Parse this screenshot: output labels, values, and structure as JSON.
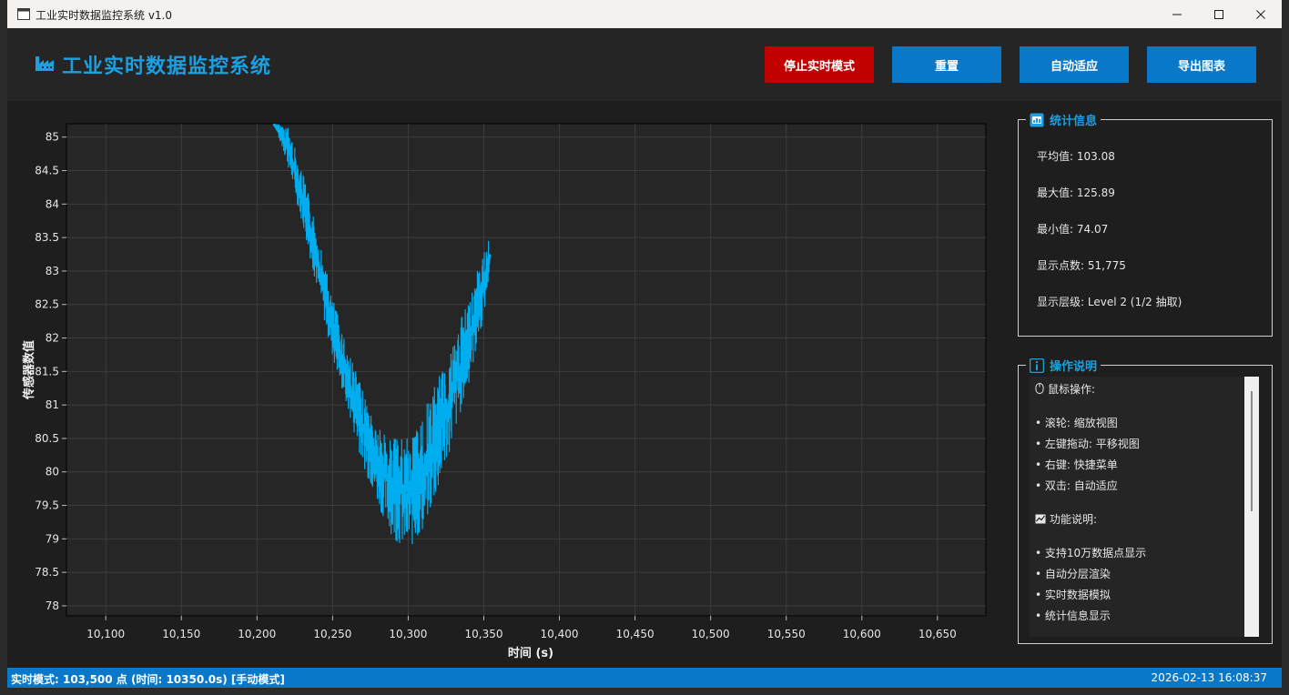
{
  "window": {
    "title": "工业实时数据监控系统 v1.0"
  },
  "header": {
    "app_title": "工业实时数据监控系统",
    "buttons": {
      "stop": "停止实时模式",
      "reset": "重置",
      "fit": "自动适应",
      "export": "导出图表"
    }
  },
  "colors": {
    "accent": "#1d9fe0",
    "stop": "#c10000",
    "button": "#0a78c8",
    "series": "#00aeef",
    "status": "#0a78c8"
  },
  "chart_data": {
    "type": "line",
    "xlabel": "时间 (s)",
    "ylabel": "传感器数值",
    "xlim": [
      10074,
      10682
    ],
    "ylim": [
      77.85,
      85.2
    ],
    "x_ticks": [
      10100,
      10150,
      10200,
      10250,
      10300,
      10350,
      10400,
      10450,
      10500,
      10550,
      10600,
      10650
    ],
    "x_tick_labels": [
      "10,100",
      "10,150",
      "10,200",
      "10,250",
      "10,300",
      "10,350",
      "10,400",
      "10,450",
      "10,500",
      "10,550",
      "10,600",
      "10,650"
    ],
    "y_ticks": [
      78,
      78.5,
      79,
      79.5,
      80,
      80.5,
      81,
      81.5,
      82,
      82.5,
      83,
      83.5,
      84,
      84.5,
      85
    ],
    "y_tick_labels": [
      "78",
      "78.5",
      "79",
      "79.5",
      "80",
      "80.5",
      "81",
      "81.5",
      "82",
      "82.5",
      "83",
      "83.5",
      "84",
      "84.5",
      "85"
    ],
    "grid": true,
    "series": [
      {
        "x": [
          10211,
          10220,
          10230,
          10240,
          10250,
          10260,
          10270,
          10280,
          10290,
          10300,
          10310,
          10320,
          10330,
          10340,
          10350,
          10354
        ],
        "low": [
          85.2,
          84.6,
          83.7,
          82.7,
          81.7,
          80.9,
          80.1,
          79.5,
          79.0,
          78.8,
          79.1,
          79.7,
          80.5,
          81.3,
          82.3,
          83.0
        ],
        "high": [
          85.2,
          85.2,
          84.5,
          83.6,
          82.6,
          81.9,
          81.2,
          80.7,
          80.5,
          80.5,
          80.9,
          81.4,
          82.0,
          82.6,
          83.3,
          83.5
        ]
      }
    ]
  },
  "stats": {
    "title": "统计信息",
    "rows": [
      "平均值: 103.08",
      "最大值: 125.89",
      "最小值: 74.07",
      "显示点数: 51,775",
      "显示层级: Level 2 (1/2 抽取)"
    ]
  },
  "help": {
    "title": "操作说明",
    "mouse_heading": "鼠标操作:",
    "mouse_items": [
      "• 滚轮: 缩放视图",
      "• 左键拖动: 平移视图",
      "• 右键: 快捷菜单",
      "• 双击: 自动适应"
    ],
    "feature_heading": "功能说明:",
    "feature_items": [
      "• 支持10万数据点显示",
      "• 自动分层渲染",
      "• 实时数据模拟",
      "• 统计信息显示"
    ]
  },
  "status": {
    "left": "实时模式: 103,500 点 (时间: 10350.0s) [手动模式]",
    "right": "2026-02-13 16:08:37"
  }
}
